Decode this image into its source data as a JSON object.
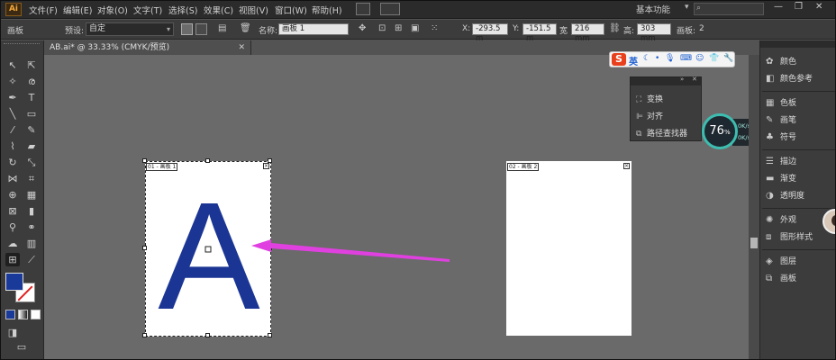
{
  "app": {
    "logo": "Ai"
  },
  "menu": [
    "文件(F)",
    "编辑(E)",
    "对象(O)",
    "文字(T)",
    "选择(S)",
    "效果(C)",
    "视图(V)",
    "窗口(W)",
    "帮助(H)"
  ],
  "workspace": {
    "label": "基本功能",
    "chevron": "▾"
  },
  "window_buttons": [
    "—",
    "❐",
    "✕"
  ],
  "control": {
    "panel_label": "画板",
    "preset_label": "预设:",
    "preset_value": "自定",
    "name_label": "名称:",
    "name_value": "画板 1",
    "x_label": "X:",
    "x_value": "-293.5 m",
    "y_label": "Y:",
    "y_value": "-151.5 m",
    "w_label": "宽",
    "w_value": "216 mm",
    "h_label": "高:",
    "h_value": "303 mm",
    "artboard_label": "画板:",
    "artboard_count": "2"
  },
  "document": {
    "tab_title": "AB.ai* @ 33.33% (CMYK/预览)",
    "close": "✕"
  },
  "artboards": [
    {
      "label": "01 - 画板 1",
      "letter": "A",
      "letter_color": "#1b3594"
    },
    {
      "label": "02 - 画板 2"
    }
  ],
  "annotation": {
    "arrow_color": "#e040e0"
  },
  "ime": {
    "logo": "S",
    "lang": "英",
    "icons": [
      "moon-icon",
      "dot-icon",
      "mic-icon",
      "keyboard-icon",
      "skin-icon",
      "shirt-icon",
      "wrench-icon"
    ]
  },
  "float_panel": {
    "items": [
      "变换",
      "对齐",
      "路径查找器"
    ]
  },
  "speed": {
    "percent": "76",
    "unit": "%",
    "up": "0K/s",
    "down": "0K/s"
  },
  "right_panel": {
    "groups": [
      [
        "颜色",
        "颜色参考"
      ],
      [
        "色板",
        "画笔",
        "符号"
      ],
      [
        "描边",
        "渐变",
        "透明度"
      ],
      [
        "外观",
        "图形样式"
      ],
      [
        "图层",
        "画板"
      ]
    ]
  },
  "colors": {
    "fill": "#1a3a9a",
    "stroke": "#ffffff",
    "accent": "#3dbdb0"
  }
}
